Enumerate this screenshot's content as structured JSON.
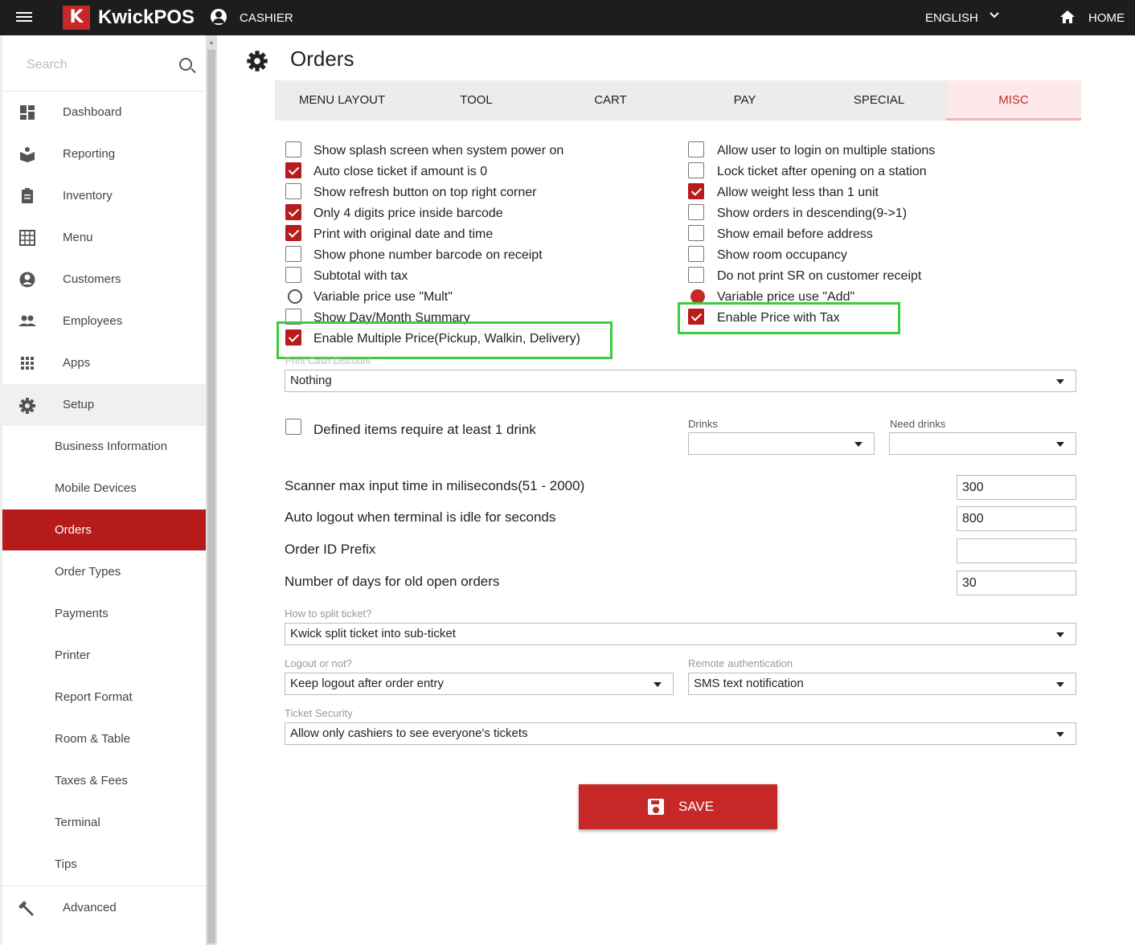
{
  "app": {
    "brand_letter": "K",
    "brand_name": "KwickPOS",
    "user_role": "CASHIER",
    "language": "ENGLISH",
    "home_label": "HOME"
  },
  "colors": {
    "accent": "#c62828",
    "active_nav": "#b71c1c",
    "highlight_box": "#3ccc3c",
    "topbar": "#1d1d1d"
  },
  "sidebar": {
    "search_placeholder": "Search",
    "items": [
      {
        "label": "Dashboard",
        "icon": "dashboard-icon"
      },
      {
        "label": "Reporting",
        "icon": "reporting-icon"
      },
      {
        "label": "Inventory",
        "icon": "inventory-icon"
      },
      {
        "label": "Menu",
        "icon": "menu-grid-icon"
      },
      {
        "label": "Customers",
        "icon": "customer-icon"
      },
      {
        "label": "Employees",
        "icon": "employees-icon"
      },
      {
        "label": "Apps",
        "icon": "apps-icon"
      },
      {
        "label": "Setup",
        "icon": "gear-icon"
      }
    ],
    "setup_children": [
      "Business Information",
      "Mobile Devices",
      "Orders",
      "Order Types",
      "Payments",
      "Printer",
      "Report Format",
      "Room & Table",
      "Taxes & Fees",
      "Terminal",
      "Tips"
    ],
    "active_item": "Orders",
    "advanced": {
      "label": "Advanced",
      "icon": "wrench-icon"
    }
  },
  "page": {
    "title": "Orders"
  },
  "tabs": [
    "MENU LAYOUT",
    "TOOL",
    "CART",
    "PAY",
    "SPECIAL",
    "MISC"
  ],
  "active_tab": "MISC",
  "left_options": [
    {
      "label": "Show splash screen when system power on",
      "checked": false
    },
    {
      "label": "Auto close ticket if amount is 0",
      "checked": true
    },
    {
      "label": "Show refresh button on top right corner",
      "checked": false
    },
    {
      "label": "Only 4 digits price inside barcode",
      "checked": true
    },
    {
      "label": "Print with original date and time",
      "checked": true
    },
    {
      "label": "Show phone number barcode on receipt",
      "checked": false
    },
    {
      "label": "Subtotal with tax",
      "checked": false
    },
    {
      "label": "Variable price use \"Mult\"",
      "checked": false,
      "radio": true
    },
    {
      "label": "Show Day/Month Summary",
      "checked": false
    },
    {
      "label": "Enable Multiple Price(Pickup, Walkin, Delivery)",
      "checked": true,
      "highlighted": true
    }
  ],
  "right_options": [
    {
      "label": "Allow user to login on multiple stations",
      "checked": false
    },
    {
      "label": "Lock ticket after opening on a station",
      "checked": false
    },
    {
      "label": "Allow weight less than 1 unit",
      "checked": true
    },
    {
      "label": "Show orders in descending(9->1)",
      "checked": false
    },
    {
      "label": "Show email before address",
      "checked": false
    },
    {
      "label": "Show room occupancy",
      "checked": false
    },
    {
      "label": "Do not print SR on customer receipt",
      "checked": false
    },
    {
      "label": "Variable price use \"Add\"",
      "checked": true,
      "radio": true
    },
    {
      "label": "Enable Price with Tax",
      "checked": true,
      "highlighted": true
    }
  ],
  "print_cash_discount": {
    "label": "Print Cash Discount",
    "value": "Nothing"
  },
  "drinks_option": {
    "label": "Defined items require at least 1 drink",
    "checked": false
  },
  "drinks": {
    "label": "Drinks",
    "value": ""
  },
  "need_drinks": {
    "label": "Need drinks",
    "value": ""
  },
  "numeric_fields": [
    {
      "label": "Scanner max input time in miliseconds(51 - 2000)",
      "value": "300"
    },
    {
      "label": "Auto logout when terminal is idle for seconds",
      "value": "800"
    },
    {
      "label": "Order ID Prefix",
      "value": ""
    },
    {
      "label": "Number of days for old open orders",
      "value": "30"
    }
  ],
  "split_ticket": {
    "label": "How to split ticket?",
    "value": "Kwick split ticket into sub-ticket"
  },
  "logout": {
    "label": "Logout or not?",
    "value": "Keep logout after order entry"
  },
  "remote_auth": {
    "label": "Remote authentication",
    "value": "SMS text notification"
  },
  "ticket_security": {
    "label": "Ticket Security",
    "value": "Allow only cashiers to see everyone's tickets"
  },
  "save_button": {
    "label": "SAVE"
  }
}
